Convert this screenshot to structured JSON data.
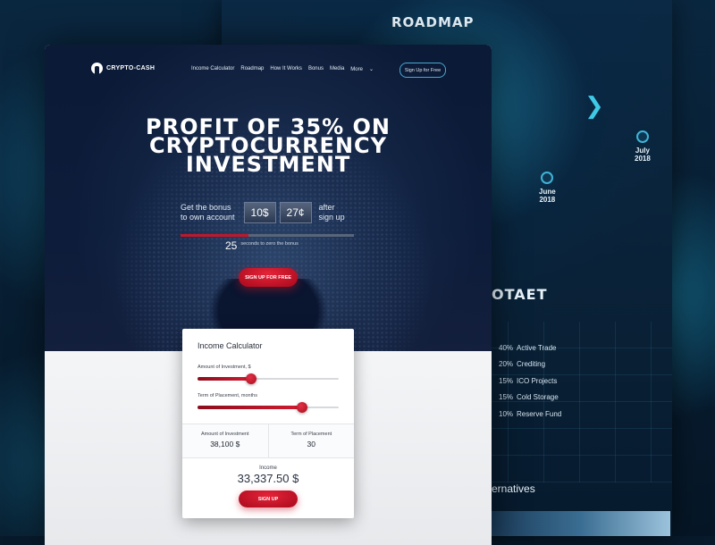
{
  "background": {
    "roadmap_title": "ROADMAP",
    "milestones": [
      {
        "month": "July",
        "year": "2018"
      },
      {
        "month": "June",
        "year": "2018"
      }
    ],
    "section_title_fragment": "OTAET",
    "allocation": [
      {
        "pct": "40%",
        "name": "Active Trade"
      },
      {
        "pct": "20%",
        "name": "Crediting"
      },
      {
        "pct": "15%",
        "name": "ICO Projects"
      },
      {
        "pct": "15%",
        "name": "Cold Storage"
      },
      {
        "pct": "10%",
        "name": "Reserve Fund"
      }
    ],
    "alternatives_fragment": "ernatives"
  },
  "nav": {
    "logo_text": "CRYPTO-CASH",
    "menu": [
      "Income Calculator",
      "Roadmap",
      "How It Works",
      "Bonus",
      "Media",
      "More"
    ],
    "more_caret": "⌄",
    "cta": "Sign Up for Free"
  },
  "hero": {
    "headline": [
      "PROFIT OF 35% ON",
      "CRYPTOCURRENCY",
      "INVESTMENT"
    ],
    "bonus_text_1": "Get the bonus",
    "bonus_text_2": "to own account",
    "bonus_dollars": "10$",
    "bonus_cents": "27¢",
    "after_1": "after",
    "after_2": "sign up",
    "timer_value": "25",
    "timer_caption": "seconds to zero the bonus",
    "timer_progress": 0.39,
    "cta": "SIGN UP FOR FREE"
  },
  "calculator": {
    "title": "Income Calculator",
    "amount_label": "Amount of Investment, $",
    "amount_level": 0.38,
    "term_label": "Term of Placement, months",
    "term_level": 0.74,
    "stats": [
      {
        "label": "Amount of Investment",
        "value": "38,100 $"
      },
      {
        "label": "Term of Placement",
        "value": "30"
      }
    ],
    "income_label": "Income",
    "income_value": "33,337.50 $",
    "cta": "SIGN UP"
  },
  "colors": {
    "accent_red": "#c0182b",
    "hero_navy": "#0b1a36",
    "cyan": "#3ec9e6"
  }
}
